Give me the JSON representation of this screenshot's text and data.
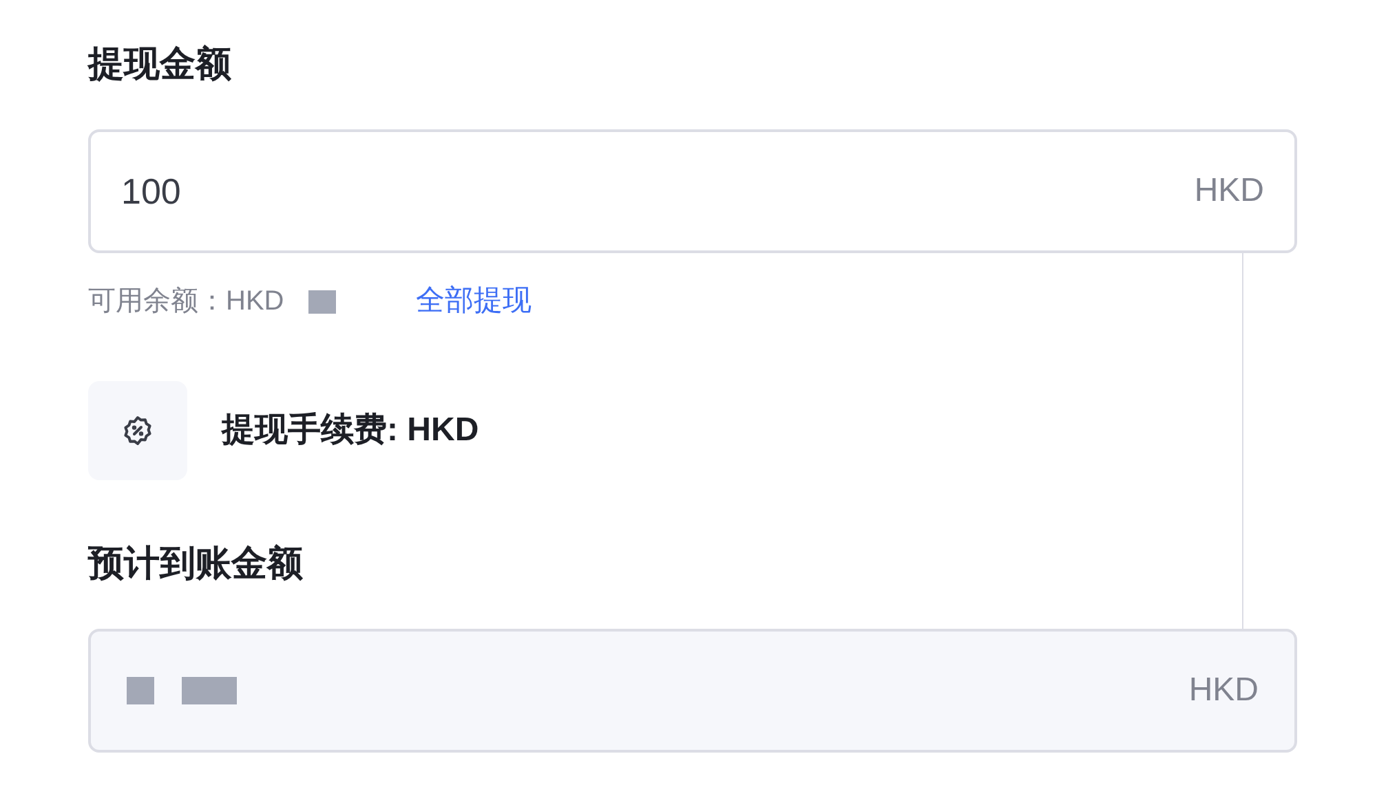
{
  "withdraw_amount": {
    "label": "提现金额",
    "value": "100",
    "currency": "HKD"
  },
  "balance": {
    "label": "可用余额：HKD",
    "action": "全部提现"
  },
  "fee": {
    "label": "提现手续费: HKD"
  },
  "expected": {
    "label": "预计到账金额",
    "currency": "HKD",
    "disabled": true
  }
}
